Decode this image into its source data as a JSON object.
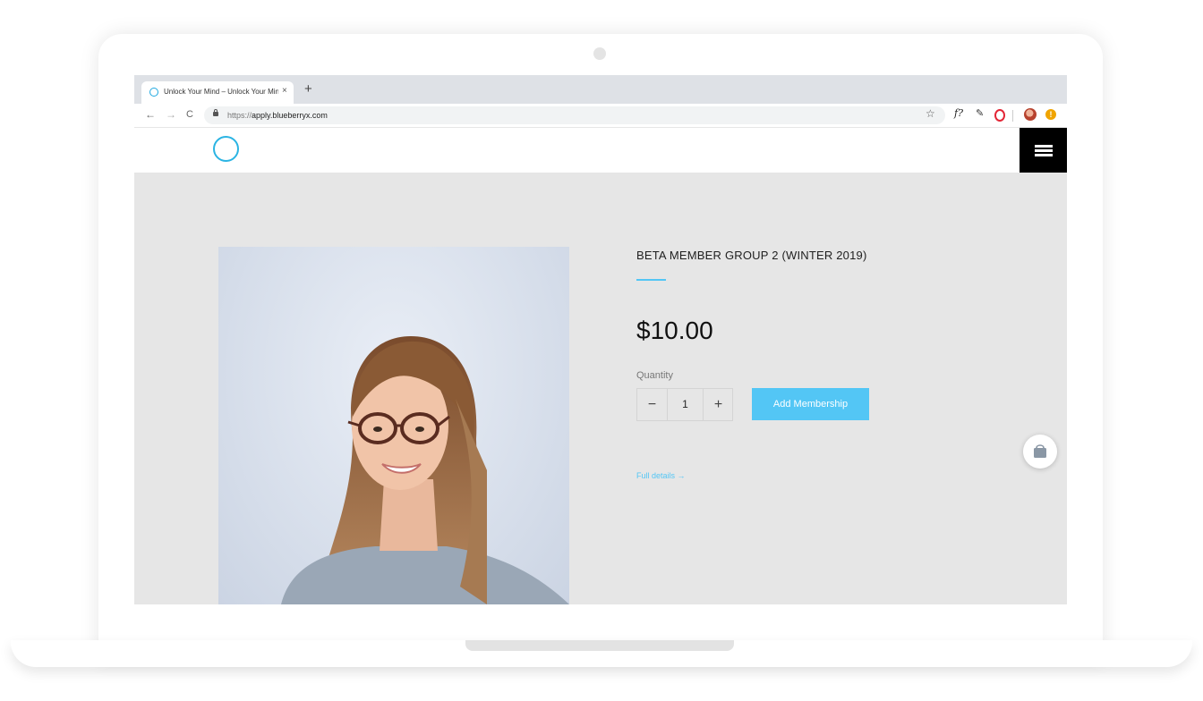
{
  "browser": {
    "tab_title": "Unlock Your Mind – Unlock Your Mind",
    "tab_close": "×",
    "new_tab": "+",
    "back": "←",
    "forward": "→",
    "reload": "C",
    "url_prefix": "https://",
    "url_host": "apply.blueberryx.com",
    "bookmark_star": "☆",
    "ext_f": "f?",
    "ext_pen": "✎",
    "ext_warn": "!"
  },
  "product": {
    "title": "BETA MEMBER GROUP 2 (WINTER 2019)",
    "price": "$10.00",
    "quantity_label": "Quantity",
    "quantity_minus": "−",
    "quantity_value": "1",
    "quantity_plus": "+",
    "add_button": "Add Membership",
    "full_details": "Full details →"
  },
  "colors": {
    "accent": "#53c6f5",
    "logo": "#2bb4e3",
    "page_bg": "#e6e6e6",
    "menu_bg": "#000000"
  },
  "icons": {
    "menu": "hamburger-icon",
    "cart": "shopping-bag-icon",
    "logo": "ring-logo-icon"
  }
}
